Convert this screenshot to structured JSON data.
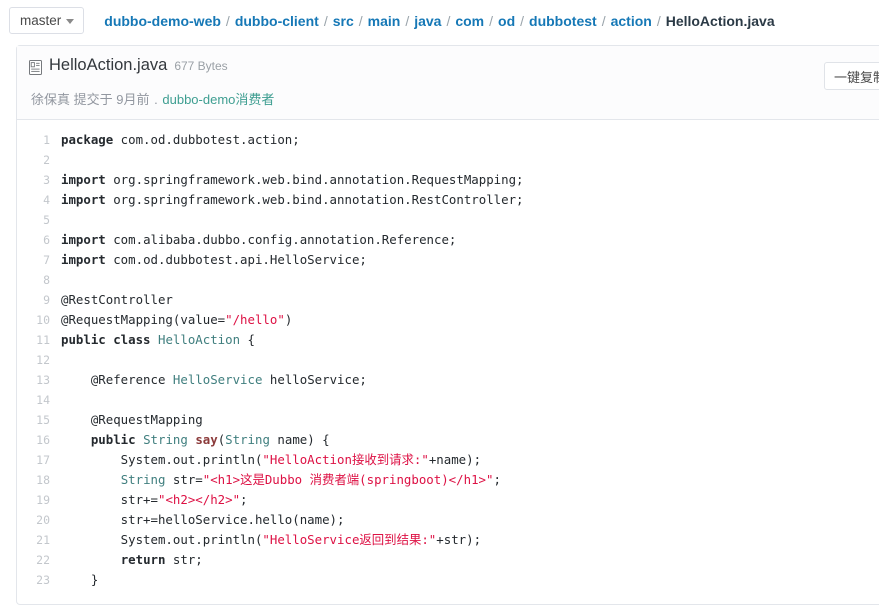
{
  "topbar": {
    "branch": {
      "label": "master",
      "icon": "chevron-down-icon"
    },
    "breadcrumb": {
      "separator": "/",
      "items": [
        {
          "label": "dubbo-demo-web",
          "current": false
        },
        {
          "label": "dubbo-client",
          "current": false
        },
        {
          "label": "src",
          "current": false
        },
        {
          "label": "main",
          "current": false
        },
        {
          "label": "java",
          "current": false
        },
        {
          "label": "com",
          "current": false
        },
        {
          "label": "od",
          "current": false
        },
        {
          "label": "dubbotest",
          "current": false
        },
        {
          "label": "action",
          "current": false
        },
        {
          "label": "HelloAction.java",
          "current": true
        }
      ]
    }
  },
  "file": {
    "icon": "file-document-icon",
    "name": "HelloAction.java",
    "size": "677 Bytes",
    "commit": {
      "author": "徐保真",
      "verb": "提交于",
      "when": "9月前",
      "dot": ".",
      "message": "dubbo-demo消费者"
    },
    "copy_button": "一键复制"
  },
  "colors": {
    "link": "#1678b6",
    "breadcrumb_current": "#2b3a46",
    "commit_message": "#3e9e91",
    "line_number": "#c3c7cc",
    "string": "#d14",
    "type": "#3f7e7e",
    "function": "#8b3a3a",
    "keyword": "#24292e",
    "panel_border": "#e3e6eb",
    "header_bg": "#fcfcfd"
  },
  "code": {
    "language": "java",
    "lines": [
      {
        "n": 1,
        "tokens": [
          {
            "t": "kw",
            "v": "package"
          },
          {
            "t": "plain",
            "v": " com.od.dubbotest.action;"
          }
        ]
      },
      {
        "n": 2,
        "tokens": []
      },
      {
        "n": 3,
        "tokens": [
          {
            "t": "kw",
            "v": "import"
          },
          {
            "t": "plain",
            "v": " org.springframework.web.bind.annotation.RequestMapping;"
          }
        ]
      },
      {
        "n": 4,
        "tokens": [
          {
            "t": "kw",
            "v": "import"
          },
          {
            "t": "plain",
            "v": " org.springframework.web.bind.annotation.RestController;"
          }
        ]
      },
      {
        "n": 5,
        "tokens": []
      },
      {
        "n": 6,
        "tokens": [
          {
            "t": "kw",
            "v": "import"
          },
          {
            "t": "plain",
            "v": " com.alibaba.dubbo.config.annotation.Reference;"
          }
        ]
      },
      {
        "n": 7,
        "tokens": [
          {
            "t": "kw",
            "v": "import"
          },
          {
            "t": "plain",
            "v": " com.od.dubbotest.api.HelloService;"
          }
        ]
      },
      {
        "n": 8,
        "tokens": []
      },
      {
        "n": 9,
        "tokens": [
          {
            "t": "ann",
            "v": "@RestController"
          }
        ]
      },
      {
        "n": 10,
        "tokens": [
          {
            "t": "ann",
            "v": "@RequestMapping(value="
          },
          {
            "t": "str",
            "v": "\"/hello\""
          },
          {
            "t": "plain",
            "v": ")"
          }
        ]
      },
      {
        "n": 11,
        "tokens": [
          {
            "t": "kw",
            "v": "public class"
          },
          {
            "t": "plain",
            "v": " "
          },
          {
            "t": "type",
            "v": "HelloAction"
          },
          {
            "t": "plain",
            "v": " {"
          }
        ]
      },
      {
        "n": 12,
        "tokens": []
      },
      {
        "n": 13,
        "tokens": [
          {
            "t": "plain",
            "v": "    "
          },
          {
            "t": "ann",
            "v": "@Reference"
          },
          {
            "t": "plain",
            "v": " "
          },
          {
            "t": "type",
            "v": "HelloService"
          },
          {
            "t": "plain",
            "v": " helloService;"
          }
        ]
      },
      {
        "n": 14,
        "tokens": []
      },
      {
        "n": 15,
        "tokens": [
          {
            "t": "plain",
            "v": "    "
          },
          {
            "t": "ann",
            "v": "@RequestMapping"
          }
        ]
      },
      {
        "n": 16,
        "tokens": [
          {
            "t": "plain",
            "v": "    "
          },
          {
            "t": "kw",
            "v": "public"
          },
          {
            "t": "plain",
            "v": " "
          },
          {
            "t": "type",
            "v": "String"
          },
          {
            "t": "plain",
            "v": " "
          },
          {
            "t": "fn",
            "v": "say"
          },
          {
            "t": "plain",
            "v": "("
          },
          {
            "t": "type",
            "v": "String"
          },
          {
            "t": "plain",
            "v": " name) {"
          }
        ]
      },
      {
        "n": 17,
        "tokens": [
          {
            "t": "plain",
            "v": "        System.out.println("
          },
          {
            "t": "str",
            "v": "\"HelloAction接收到请求:\""
          },
          {
            "t": "plain",
            "v": "+name);"
          }
        ]
      },
      {
        "n": 18,
        "tokens": [
          {
            "t": "plain",
            "v": "        "
          },
          {
            "t": "type",
            "v": "String"
          },
          {
            "t": "plain",
            "v": " str="
          },
          {
            "t": "str",
            "v": "\"<h1>这是Dubbo 消费者端(springboot)</h1>\""
          },
          {
            "t": "plain",
            "v": ";"
          }
        ]
      },
      {
        "n": 19,
        "tokens": [
          {
            "t": "plain",
            "v": "        str+="
          },
          {
            "t": "str",
            "v": "\"<h2></h2>\""
          },
          {
            "t": "plain",
            "v": ";"
          }
        ]
      },
      {
        "n": 20,
        "tokens": [
          {
            "t": "plain",
            "v": "        str+=helloService.hello(name);"
          }
        ]
      },
      {
        "n": 21,
        "tokens": [
          {
            "t": "plain",
            "v": "        System.out.println("
          },
          {
            "t": "str",
            "v": "\"HelloService返回到结果:\""
          },
          {
            "t": "plain",
            "v": "+str);"
          }
        ]
      },
      {
        "n": 22,
        "tokens": [
          {
            "t": "plain",
            "v": "        "
          },
          {
            "t": "kw",
            "v": "return"
          },
          {
            "t": "plain",
            "v": " str;"
          }
        ]
      },
      {
        "n": 23,
        "tokens": [
          {
            "t": "plain",
            "v": "    }"
          }
        ]
      }
    ]
  }
}
